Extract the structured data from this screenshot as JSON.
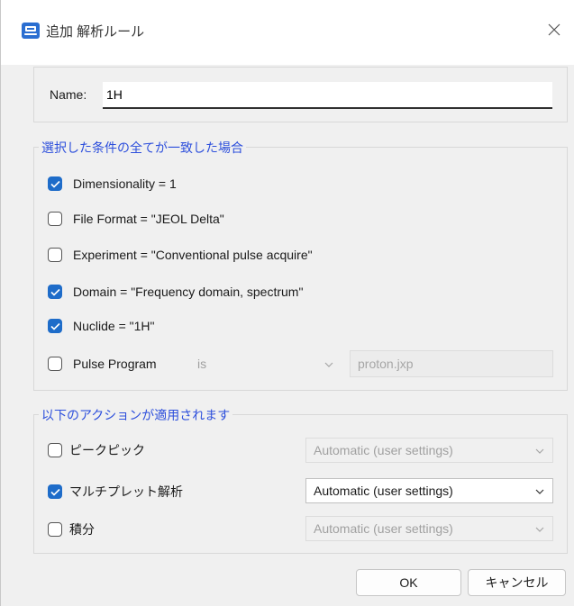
{
  "window": {
    "title": "追加 解析ルール",
    "accent": "#1e6cc9",
    "group_title_color": "#2d4fdc"
  },
  "name_field": {
    "label": "Name:",
    "value": "1H"
  },
  "conditions": {
    "title": "選択した条件の全てが一致した場合",
    "items": [
      {
        "label": "Dimensionality = 1",
        "checked": true
      },
      {
        "label": "File Format = \"JEOL Delta\"",
        "checked": false
      },
      {
        "label": "Experiment = \"Conventional pulse acquire\"",
        "checked": false
      },
      {
        "label": "Domain = \"Frequency domain, spectrum\"",
        "checked": true
      },
      {
        "label": "Nuclide = \"1H\"",
        "checked": true
      },
      {
        "label": "Pulse Program",
        "checked": false
      }
    ],
    "pulse_operator": "is",
    "pulse_value": "proton.jxp"
  },
  "actions": {
    "title": "以下のアクションが適用されます",
    "items": [
      {
        "label": "ピークピック",
        "checked": false,
        "option": "Automatic (user settings)",
        "enabled": false
      },
      {
        "label": "マルチプレット解析",
        "checked": true,
        "option": "Automatic (user settings)",
        "enabled": true
      },
      {
        "label": "積分",
        "checked": false,
        "option": "Automatic (user settings)",
        "enabled": false
      }
    ]
  },
  "buttons": {
    "ok": "OK",
    "cancel": "キャンセル"
  }
}
